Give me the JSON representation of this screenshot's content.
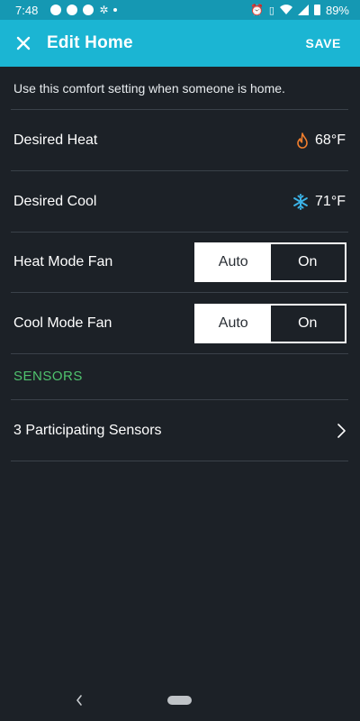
{
  "status_bar": {
    "time": "7:48",
    "battery": "89%",
    "left_icons": [
      "messenger-icon",
      "messenger-icon",
      "pinterest-icon",
      "nbc-icon"
    ],
    "right_icons": [
      "alarm-icon",
      "vibrate-icon",
      "wifi-icon",
      "signal-icon",
      "battery-icon"
    ]
  },
  "app_bar": {
    "title": "Edit Home",
    "save_label": "SAVE",
    "background": "#1bb5d3"
  },
  "description": "Use this comfort setting when someone is home.",
  "rows": {
    "desired_heat": {
      "label": "Desired Heat",
      "value": "68°F",
      "icon": "flame-icon",
      "icon_color": "#f07e2d"
    },
    "desired_cool": {
      "label": "Desired Cool",
      "value": "71°F",
      "icon": "snowflake-icon",
      "icon_color": "#3bb2e6"
    },
    "heat_mode_fan": {
      "label": "Heat Mode Fan",
      "options": [
        "Auto",
        "On"
      ],
      "selected": "Auto"
    },
    "cool_mode_fan": {
      "label": "Cool Mode Fan",
      "options": [
        "Auto",
        "On"
      ],
      "selected": "Auto"
    }
  },
  "sensors": {
    "section_title": "SENSORS",
    "section_color": "#4fc36e",
    "participating_label": "3 Participating Sensors"
  }
}
